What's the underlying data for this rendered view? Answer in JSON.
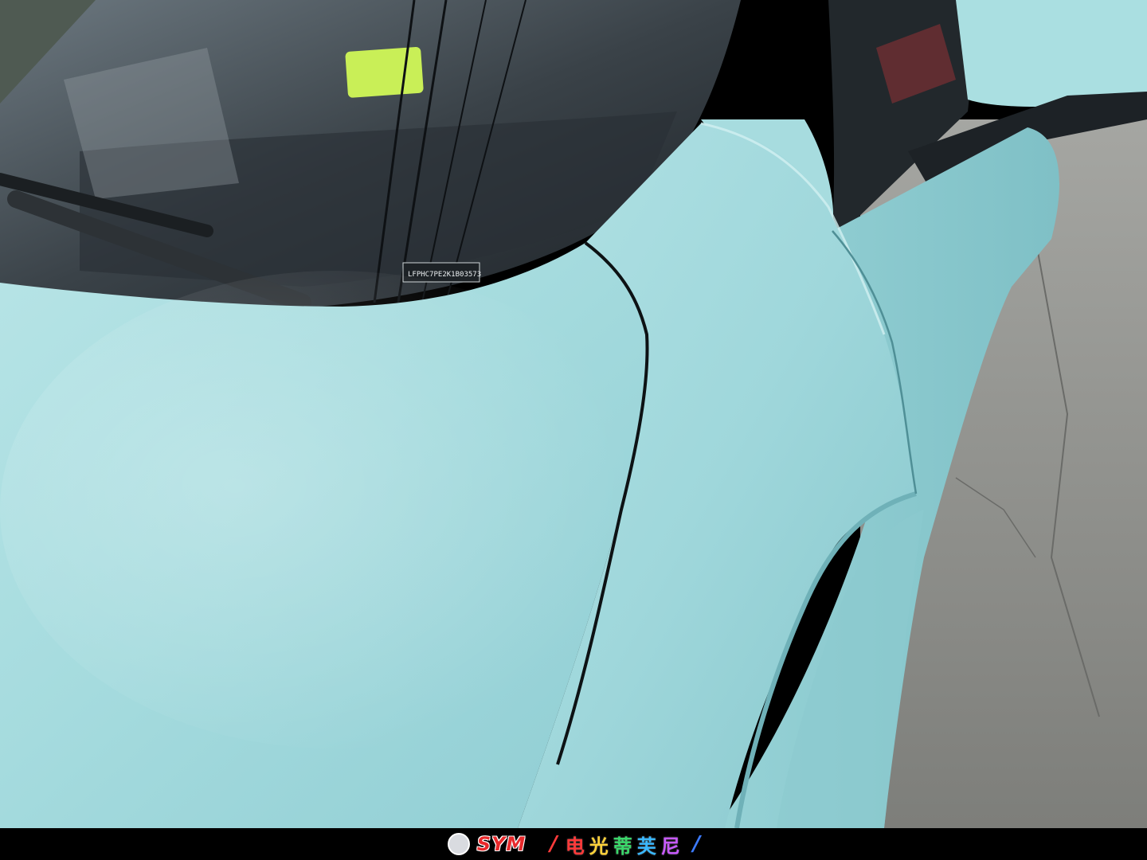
{
  "photo": {
    "subject": "light-blue-wrapped-car-front-fender",
    "wrap_color": "#a9dde0",
    "windshield_sticker_text": "LFPHC7PE2K1B03573"
  },
  "footer": {
    "brand": "SYM",
    "brand_color": "#e8292b",
    "slogan_chars": [
      {
        "char": "电",
        "color": "#ff3a3a"
      },
      {
        "char": "光",
        "color": "#ffd23a"
      },
      {
        "char": "蒂",
        "color": "#3ad86a"
      },
      {
        "char": "芙",
        "color": "#3ab8ff"
      },
      {
        "char": "尼",
        "color": "#c85aff"
      }
    ]
  }
}
